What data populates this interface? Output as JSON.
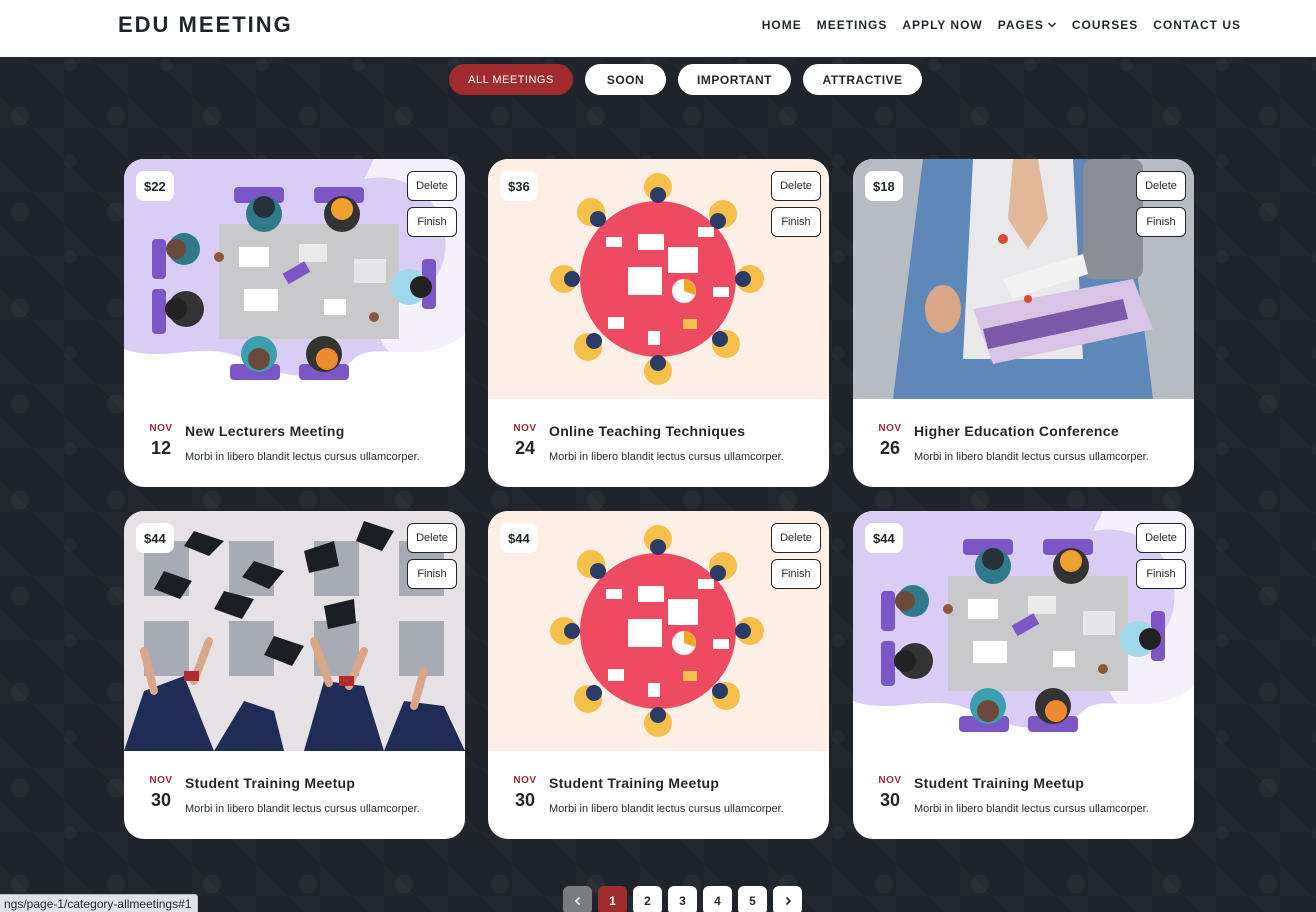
{
  "header": {
    "logo": "EDU MEETING",
    "nav": [
      "HOME",
      "MEETINGS",
      "APPLY NOW",
      "PAGES",
      "COURSES",
      "CONTACT US"
    ]
  },
  "filters": [
    "ALL MEETINGS",
    "SOON",
    "IMPORTANT",
    "ATTRACTIVE"
  ],
  "filters_active": "ALL MEETINGS",
  "cards": [
    {
      "price": "$22",
      "month": "NOV",
      "day": "12",
      "title": "New Lecturers Meeting",
      "desc": "Morbi in libero blandit lectus cursus ullamcorper.",
      "image": "meeting-table-illustration"
    },
    {
      "price": "$36",
      "month": "NOV",
      "day": "24",
      "title": "Online Teaching Techniques",
      "desc": "Morbi in libero blandit lectus cursus ullamcorper.",
      "image": "round-table-illustration"
    },
    {
      "price": "$18",
      "month": "NOV",
      "day": "26",
      "title": "Higher Education Conference",
      "desc": "Morbi in libero blandit lectus cursus ullamcorper.",
      "image": "student-with-books-photo"
    },
    {
      "price": "$44",
      "month": "NOV",
      "day": "30",
      "title": "Student Training Meetup",
      "desc": "Morbi in libero blandit lectus cursus ullamcorper.",
      "image": "graduation-caps-photo"
    },
    {
      "price": "$44",
      "month": "NOV",
      "day": "30",
      "title": "Student Training Meetup",
      "desc": "Morbi in libero blandit lectus cursus ullamcorper.",
      "image": "round-table-illustration"
    },
    {
      "price": "$44",
      "month": "NOV",
      "day": "30",
      "title": "Student Training Meetup",
      "desc": "Morbi in libero blandit lectus cursus ullamcorper.",
      "image": "meeting-table-illustration"
    }
  ],
  "card_actions": {
    "delete": "Delete",
    "finish": "Finish"
  },
  "pagination": {
    "pages": [
      "1",
      "2",
      "3",
      "4",
      "5"
    ],
    "current": "1"
  },
  "status_url": "ngs/page-1/category-allmeetings#1",
  "colors": {
    "accent": "#a12c2f",
    "background": "#1e2429",
    "text": "#1f272b"
  }
}
